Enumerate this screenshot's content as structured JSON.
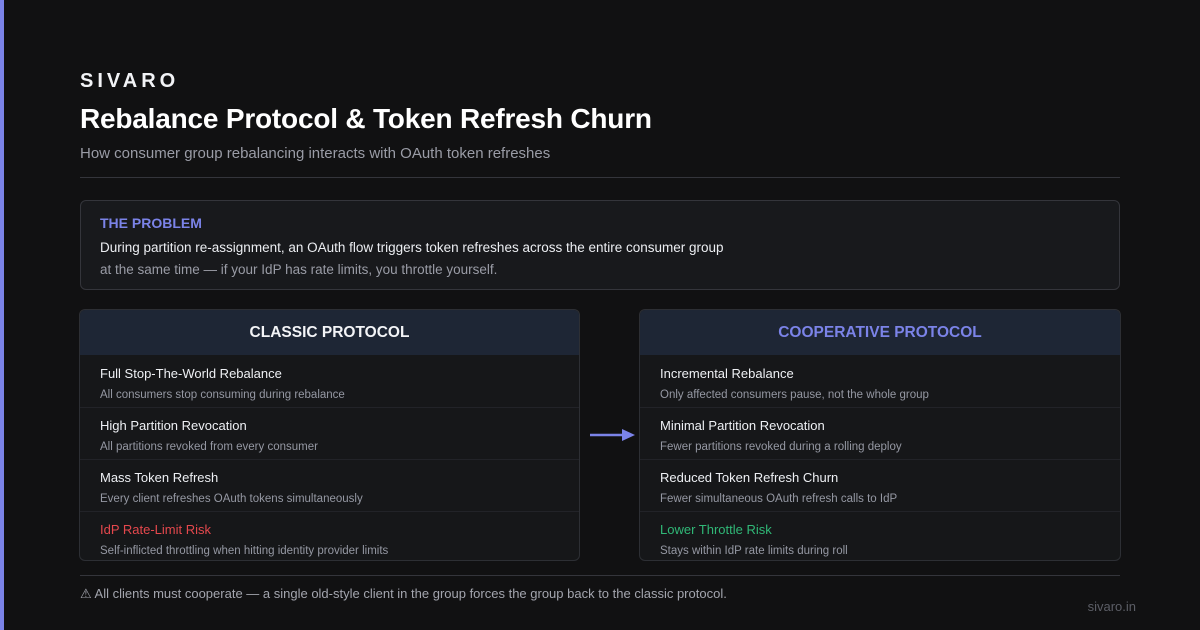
{
  "brand": "SIVARO",
  "title": "Rebalance Protocol & Token Refresh Churn",
  "subtitle": "How consumer group rebalancing interacts with OAuth token refreshes",
  "problem": {
    "heading": "THE PROBLEM",
    "line1": "During partition re-assignment, an OAuth flow triggers token refreshes across the entire consumer group",
    "line2": "at the same time — if your IdP has rate limits, you throttle yourself."
  },
  "classic": {
    "title": "CLASSIC PROTOCOL",
    "items": [
      {
        "name": "Full Stop-The-World Rebalance",
        "desc": "All consumers stop consuming during rebalance"
      },
      {
        "name": "High Partition Revocation",
        "desc": "All partitions revoked from every consumer"
      },
      {
        "name": "Mass Token Refresh",
        "desc": "Every client refreshes OAuth tokens simultaneously"
      },
      {
        "name": "IdP Rate-Limit Risk",
        "desc": "Self-inflicted throttling when hitting identity provider limits"
      }
    ]
  },
  "cooperative": {
    "title": "COOPERATIVE PROTOCOL",
    "items": [
      {
        "name": "Incremental Rebalance",
        "desc": "Only affected consumers pause, not the whole group"
      },
      {
        "name": "Minimal Partition Revocation",
        "desc": "Fewer partitions revoked during a rolling deploy"
      },
      {
        "name": "Reduced Token Refresh Churn",
        "desc": "Fewer simultaneous OAuth refresh calls to IdP"
      },
      {
        "name": "Lower Throttle Risk",
        "desc": "Stays within IdP rate limits during roll"
      }
    ]
  },
  "arrow_icon": "arrow-right-icon",
  "footer_note": "⚠ All clients must cooperate — a single old-style client in the group forces the group back to the classic protocol.",
  "domain": "sivaro.in",
  "colors": {
    "accent": "#7b83e8",
    "risk": "#e5484d",
    "safe": "#30b877",
    "background": "#111112"
  }
}
